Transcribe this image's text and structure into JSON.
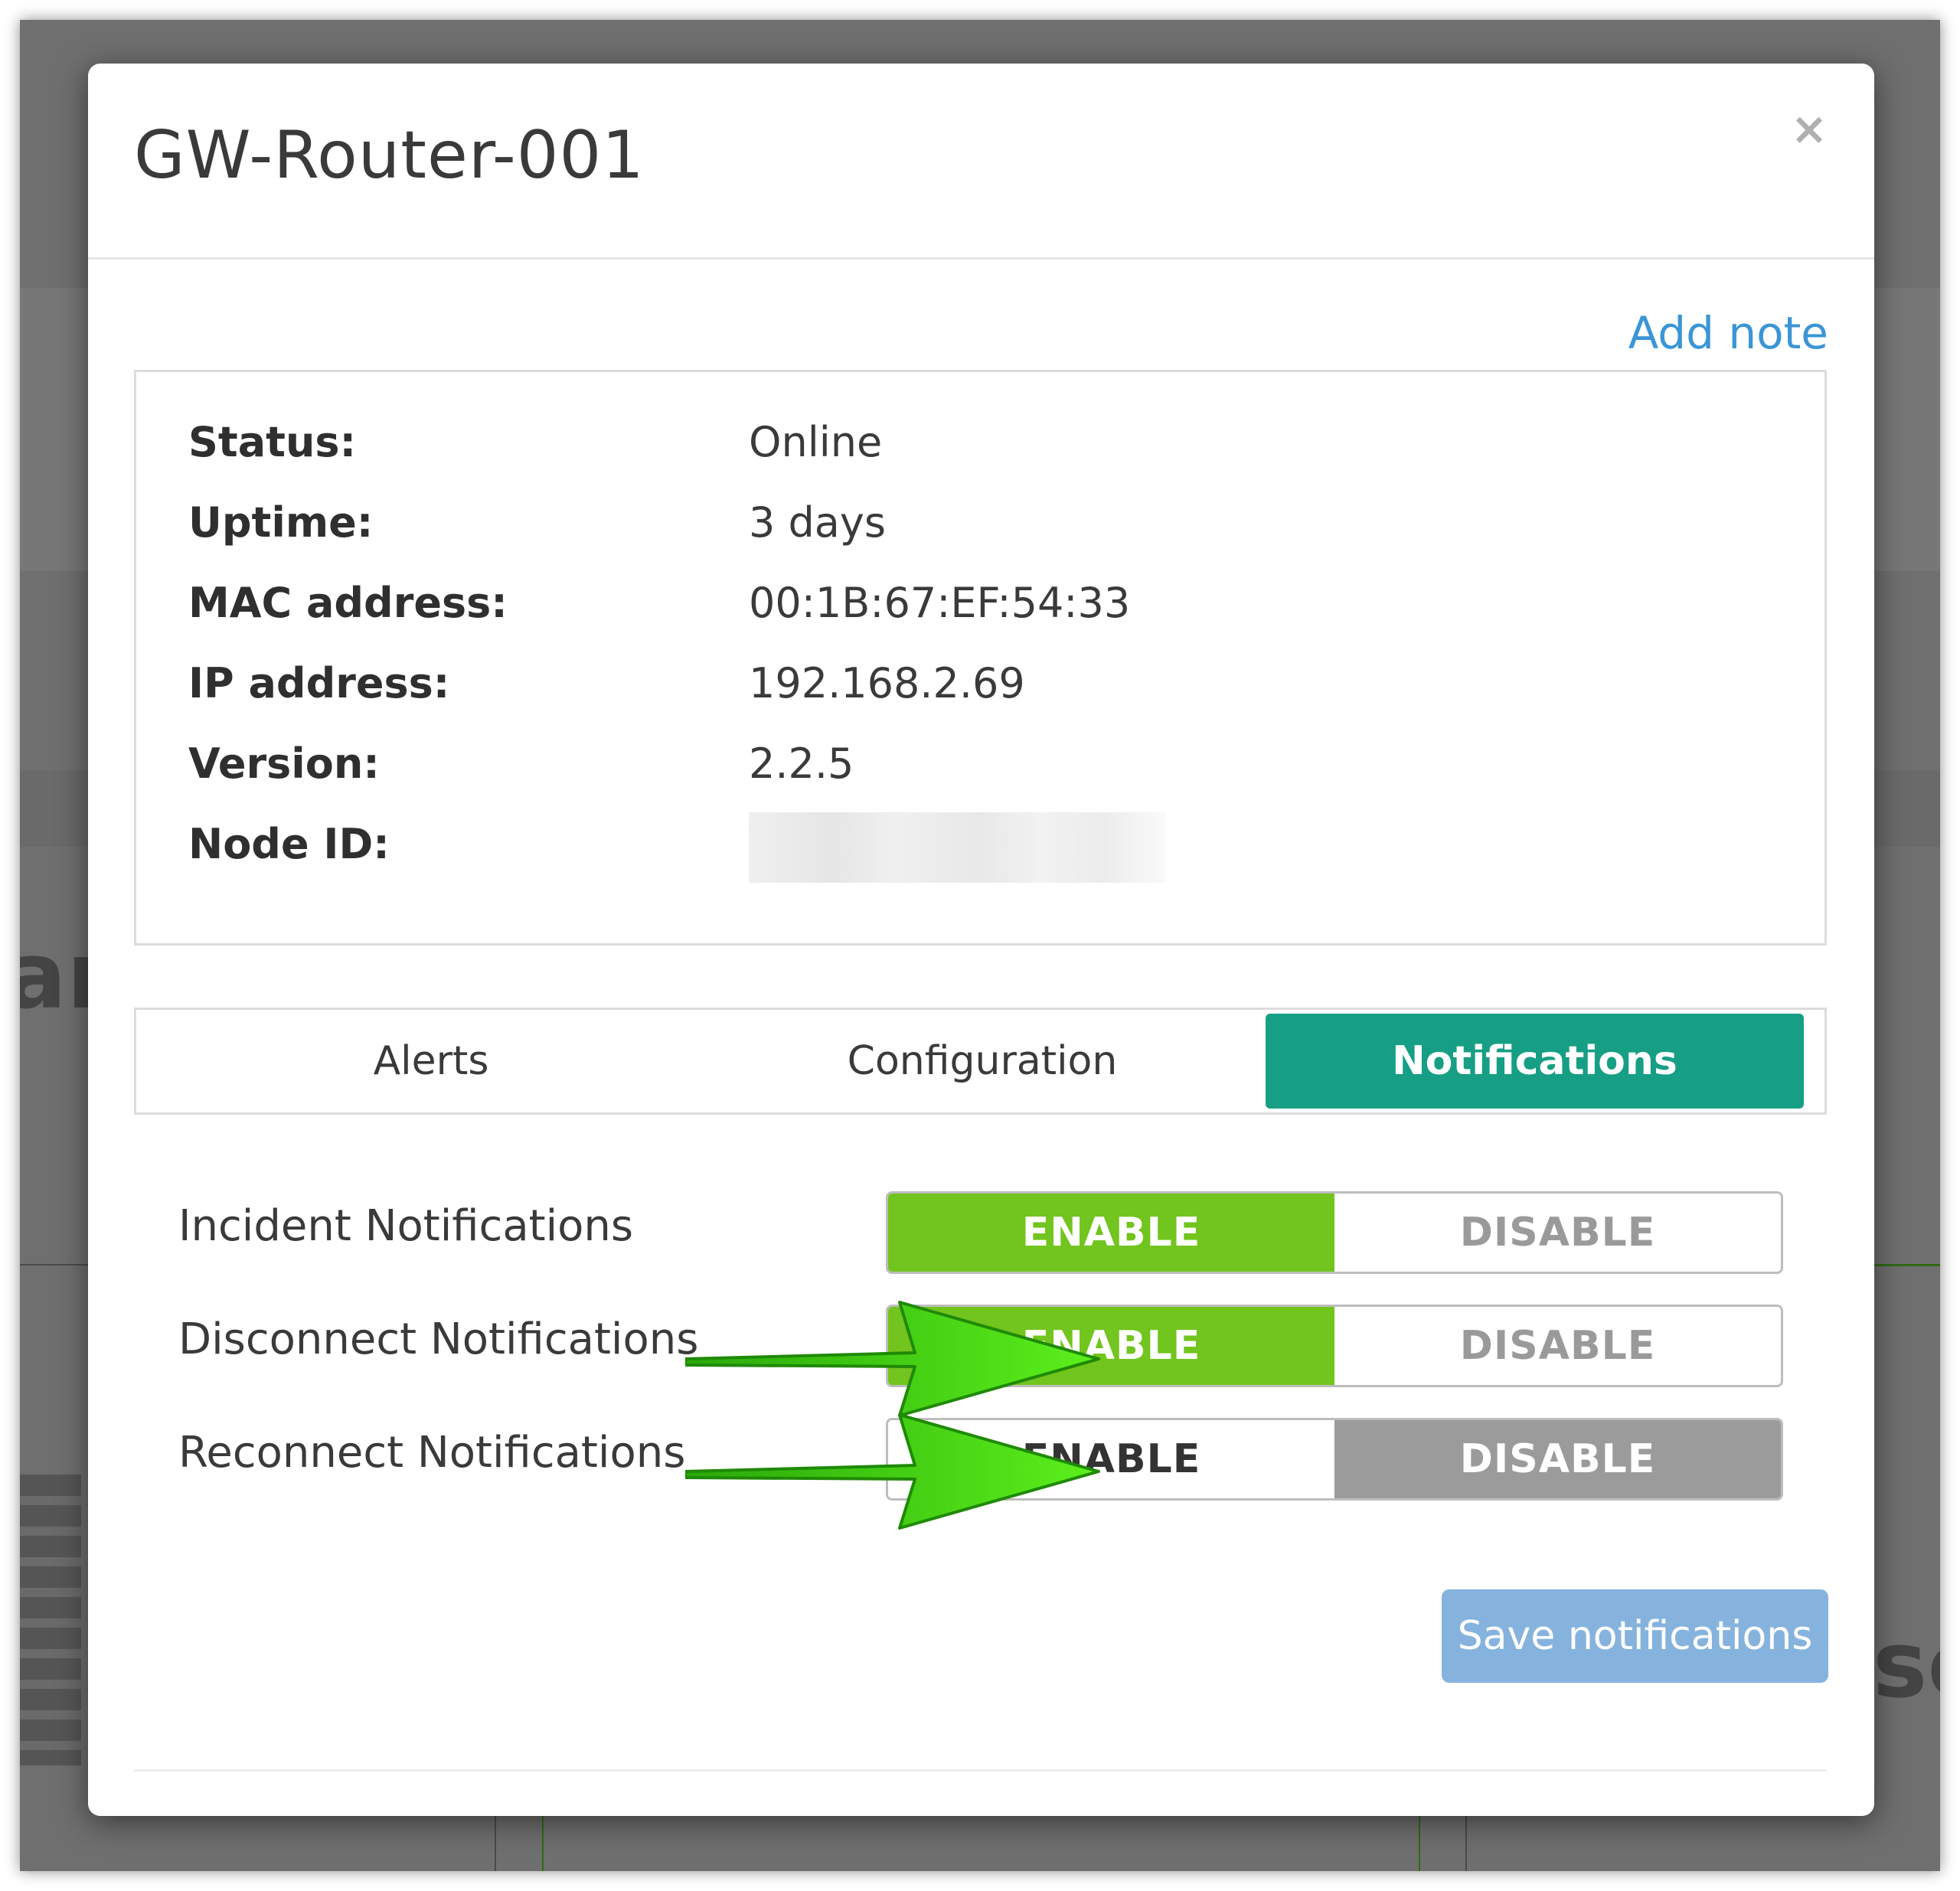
{
  "modal": {
    "title": "GW-Router-001",
    "close_glyph": "×",
    "add_note": "Add note"
  },
  "info": [
    {
      "label": "Status:",
      "value": "Online"
    },
    {
      "label": "Uptime:",
      "value": "3 days"
    },
    {
      "label": "MAC address:",
      "value": "00:1B:67:EF:54:33"
    },
    {
      "label": "IP address:",
      "value": "192.168.2.69"
    },
    {
      "label": "Version:",
      "value": "2.2.5"
    },
    {
      "label": "Node ID:",
      "value": ""
    }
  ],
  "tabs": [
    {
      "label": "Alerts",
      "active": false
    },
    {
      "label": "Configuration",
      "active": false
    },
    {
      "label": "Notifications",
      "active": true
    }
  ],
  "notifications": [
    {
      "label": "Incident Notifications",
      "enable": "ENABLE",
      "disable": "DISABLE",
      "state": "enabled"
    },
    {
      "label": "Disconnect Notifications",
      "enable": "ENABLE",
      "disable": "DISABLE",
      "state": "enabled"
    },
    {
      "label": "Reconnect Notifications",
      "enable": "ENABLE",
      "disable": "DISABLE",
      "state": "disabled"
    }
  ],
  "save_button": "Save notifications",
  "background_text": {
    "left": "are",
    "right": "sc"
  },
  "colors": {
    "accent_tab": "#169f84",
    "enable_green": "#72c41e",
    "disable_gray": "#9b9b9b",
    "link_blue": "#3b95d6",
    "save_button": "#85b3dd",
    "annotation_arrow": "#4fdc12"
  },
  "icons": {
    "close": "close-icon",
    "arrow": "annotation-arrow-icon"
  }
}
